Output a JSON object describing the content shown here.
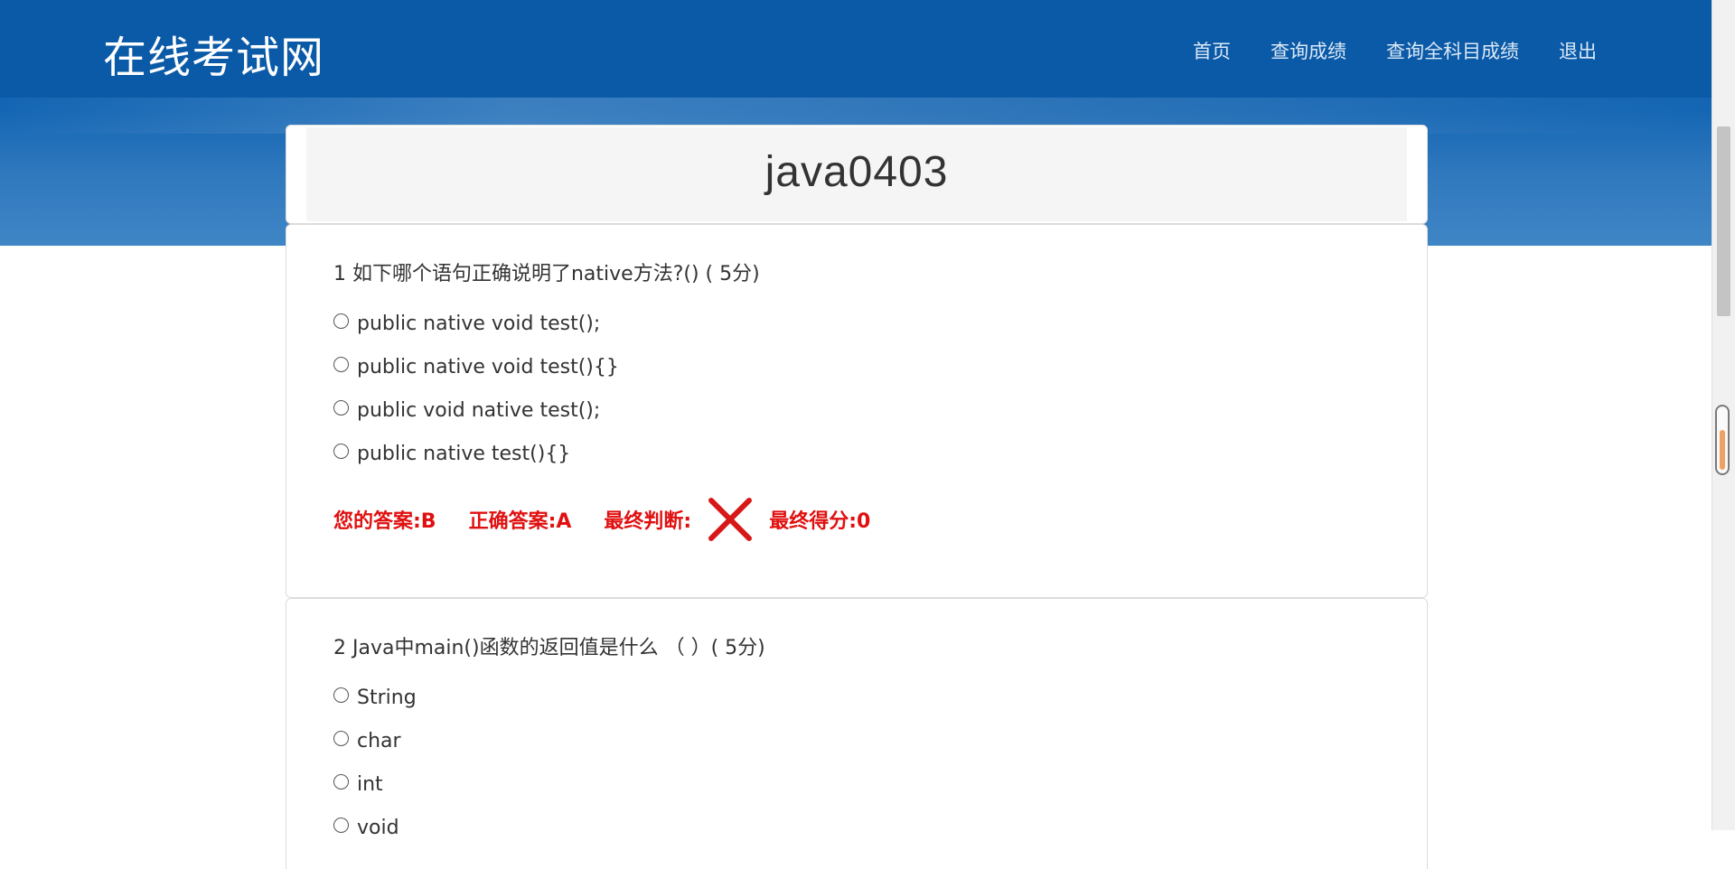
{
  "header": {
    "brand": "在线考试网",
    "nav": [
      "首页",
      "查询成绩",
      "查询全科目成绩",
      "退出"
    ]
  },
  "exam": {
    "title": "java0403"
  },
  "questions": [
    {
      "text": "1 如下哪个语句正确说明了native方法?() ( 5分)",
      "options": [
        "public native void test();",
        "public native void test(){}",
        "public void native test();",
        "public native test(){}"
      ],
      "result": {
        "your_answer": "您的答案:B",
        "correct_answer": "正确答案:A",
        "final_judgement_label": "最终判断:",
        "final_judgement_icon": "red-x-icon",
        "final_score": "最终得分:0"
      }
    },
    {
      "text": "2 Java中main()函数的返回值是什么 （ ）( 5分)",
      "options": [
        "String",
        "char",
        "int",
        "void"
      ]
    }
  ],
  "colors": {
    "header_blue": "#0b5aa7",
    "result_red": "#e01010"
  }
}
